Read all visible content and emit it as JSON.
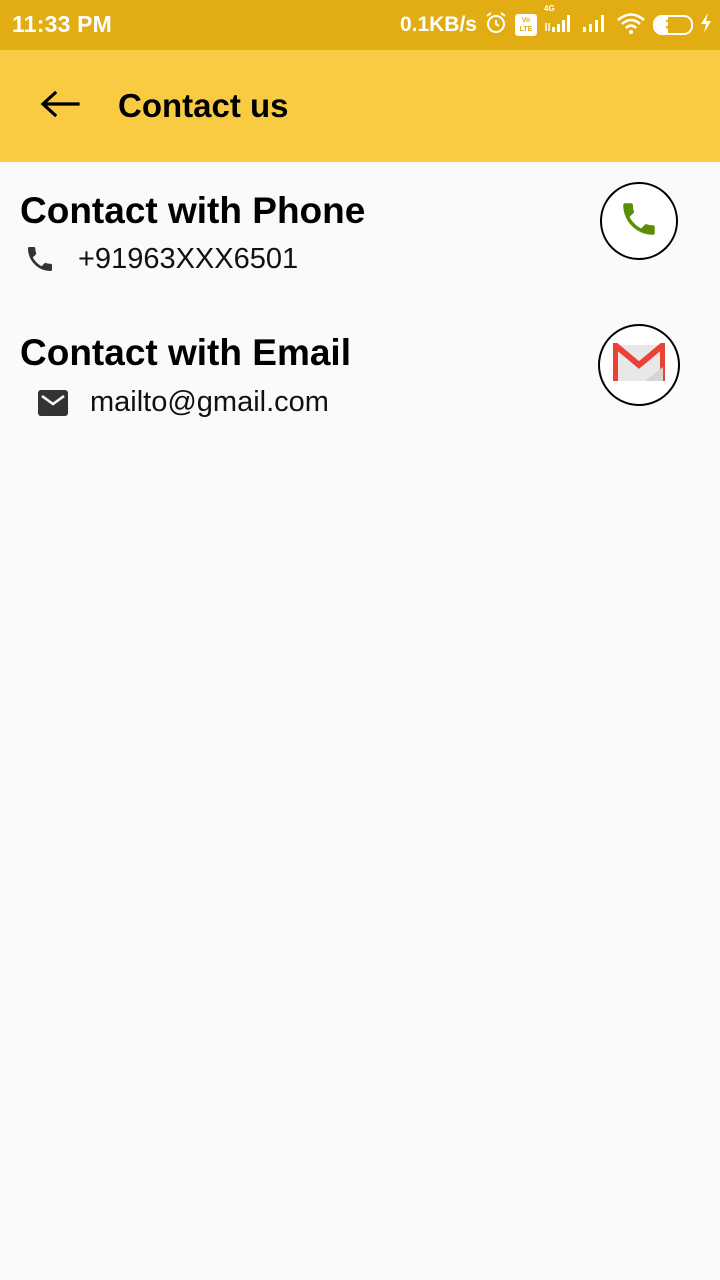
{
  "status_bar": {
    "time": "11:33 PM",
    "net_speed": "0.1KB/s",
    "volte_label": "Vo LTE",
    "network_type": "4G",
    "battery_level": "37",
    "battery_fraction": 0.37,
    "icons": [
      "alarm-icon",
      "volte-icon",
      "signal-4g-icon",
      "signal-icon",
      "wifi-icon",
      "battery-icon",
      "charging-icon"
    ]
  },
  "toolbar": {
    "title": "Contact us",
    "back_icon": "arrow-back-icon",
    "color": "#f9cb43"
  },
  "contact_phone": {
    "title": "Contact with Phone",
    "value": "+91963XXX6501",
    "row_icon": "phone-icon",
    "action_icon": "phone-call-icon",
    "action_color": "#5b8f00"
  },
  "contact_email": {
    "title": "Contact with Email",
    "value": "mailto@gmail.com",
    "row_icon": "email-icon",
    "action_icon": "gmail-icon",
    "action_color": "#ea4335"
  },
  "colors": {
    "status_bar": "#e2ad12",
    "background": "#fafafa"
  }
}
